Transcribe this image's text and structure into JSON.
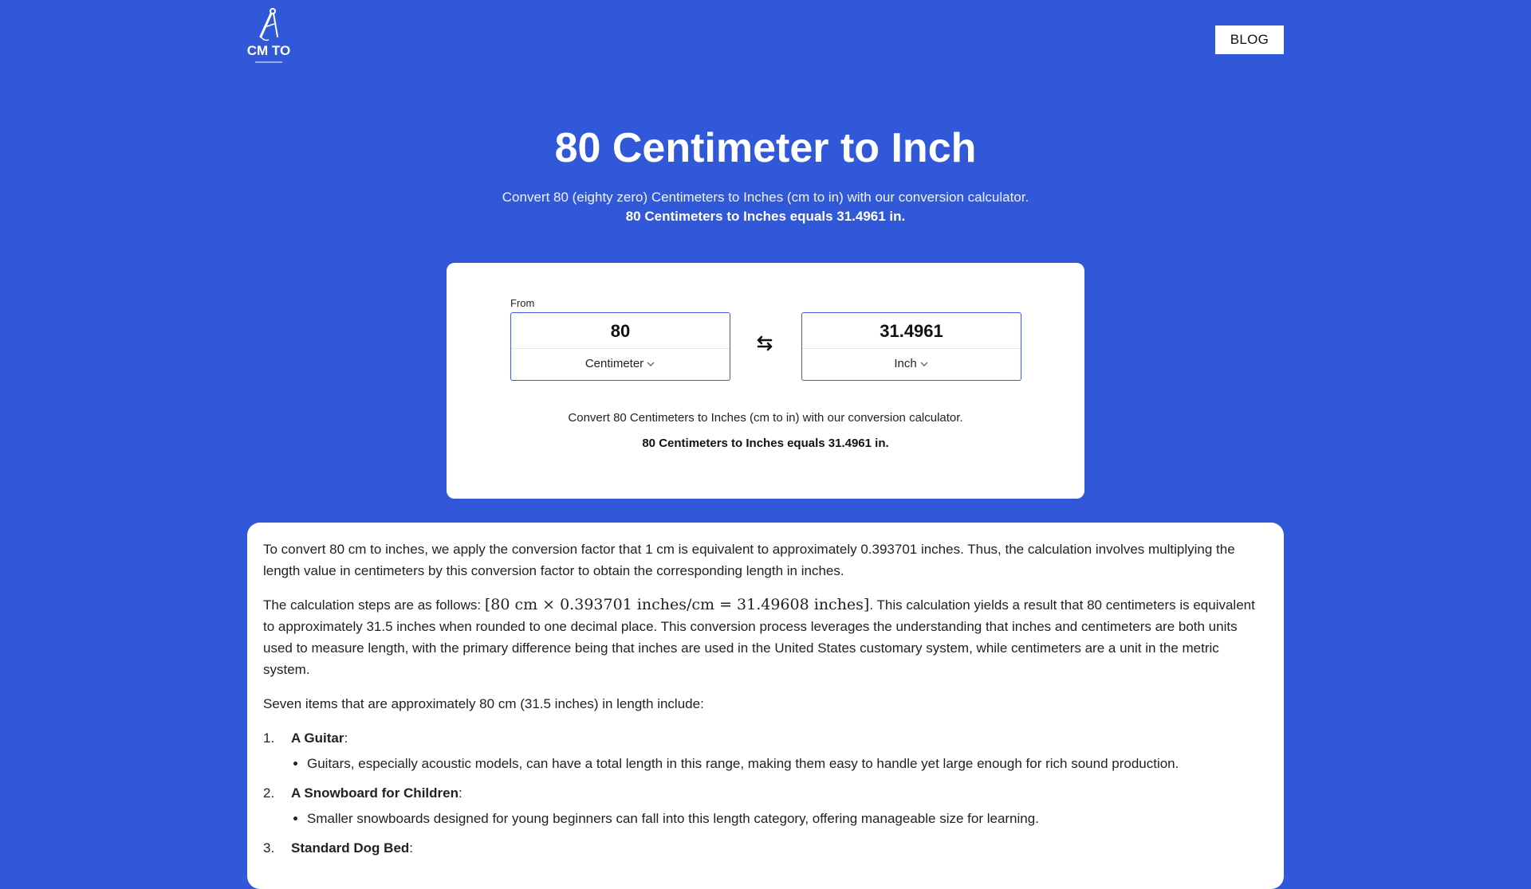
{
  "header": {
    "logo_text": "CM TO",
    "blog_label": "BLOG"
  },
  "hero": {
    "title": "80 Centimeter to Inch",
    "subtitle": "Convert 80 (eighty zero) Centimeters to Inches (cm to in) with our conversion calculator.",
    "result": "80 Centimeters to Inches equals 31.4961 in."
  },
  "converter": {
    "from_label": "From",
    "from_value": "80",
    "from_unit": "Centimeter",
    "to_value": "31.4961",
    "to_unit": "Inch",
    "note": "Convert 80 Centimeters to Inches (cm to in) with our conversion calculator.",
    "result": "80 Centimeters to Inches equals 31.4961 in."
  },
  "content": {
    "p1": "To convert 80 cm to inches, we apply the conversion factor that 1 cm is equivalent to approximately 0.393701 inches. Thus, the calculation involves multiplying the length value in centimeters by this conversion factor to obtain the corresponding length in inches.",
    "p2_prefix": "The calculation steps are as follows: ",
    "p2_math": "[80 cm × 0.393701 inches/cm = 31.49608 inches]",
    "p2_suffix": ". This calculation yields a result that 80 centimeters is equivalent to approximately 31.5 inches when rounded to one decimal place. This conversion process leverages the understanding that inches and centimeters are both units used to measure length, with the primary difference being that inches are used in the United States customary system, while centimeters are a unit in the metric system.",
    "p3": "Seven items that are approximately 80 cm (31.5 inches) in length include:",
    "items": [
      {
        "num": "1.",
        "title": "A Guitar",
        "desc": "Guitars, especially acoustic models, can have a total length in this range, making them easy to handle yet large enough for rich sound production."
      },
      {
        "num": "2.",
        "title": "A Snowboard for Children",
        "desc": "Smaller snowboards designed for young beginners can fall into this length category, offering manageable size for learning."
      },
      {
        "num": "3.",
        "title": "Standard Dog Bed",
        "desc": ""
      }
    ]
  }
}
